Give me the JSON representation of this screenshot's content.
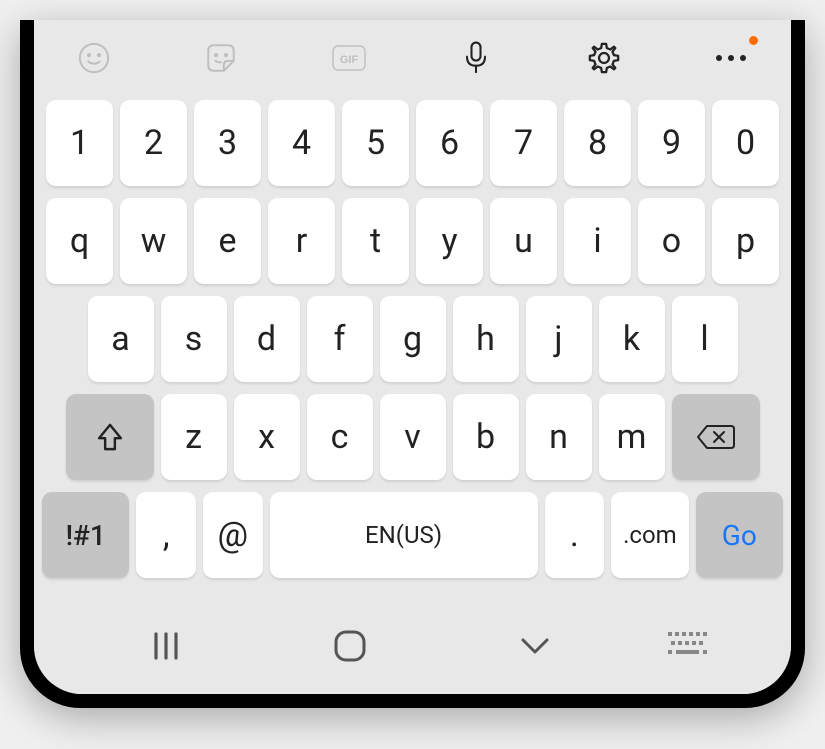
{
  "row_numbers": [
    "1",
    "2",
    "3",
    "4",
    "5",
    "6",
    "7",
    "8",
    "9",
    "0"
  ],
  "row_qwerty": [
    "q",
    "w",
    "e",
    "r",
    "t",
    "y",
    "u",
    "i",
    "o",
    "p"
  ],
  "row_asdf": [
    "a",
    "s",
    "d",
    "f",
    "g",
    "h",
    "j",
    "k",
    "l"
  ],
  "row_zxcv": [
    "z",
    "x",
    "c",
    "v",
    "b",
    "n",
    "m"
  ],
  "row_bottom": {
    "sym": "!#1",
    "comma": ",",
    "at": "@",
    "space": "EN(US)",
    "dot": ".",
    "com": ".com",
    "go": "Go"
  }
}
